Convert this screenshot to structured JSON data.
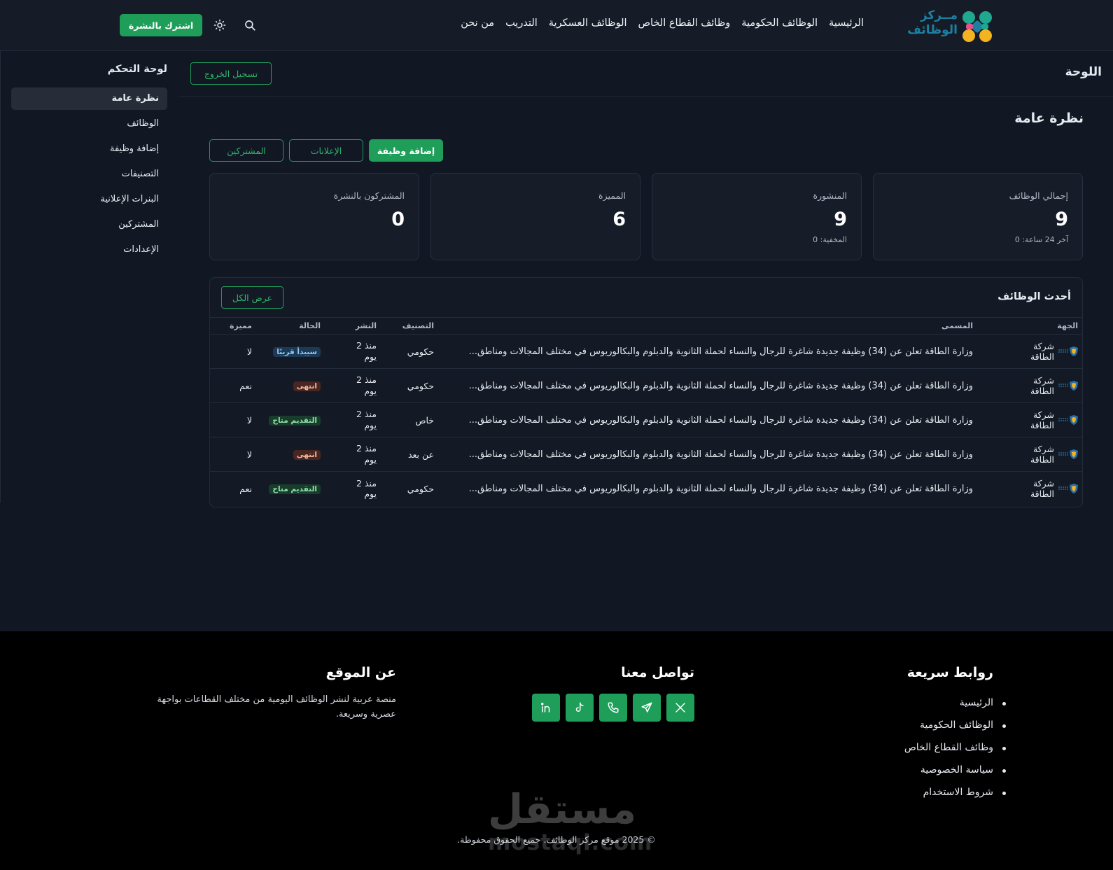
{
  "header": {
    "logo_line1": "مــركز",
    "logo_line2": "الوظائف",
    "nav": [
      "الرئيسية",
      "الوظائف الحكومية",
      "وظائف القطاع الخاص",
      "الوظائف العسكرية",
      "التدريب",
      "من نحن"
    ],
    "subscribe_label": "اشترك بالنشرة",
    "search_icon": "search-icon",
    "theme_icon": "sun-icon"
  },
  "sidebar": {
    "title": "لوحة التحكم",
    "items": [
      {
        "label": "نظرة عامة",
        "active": true
      },
      {
        "label": "الوظائف"
      },
      {
        "label": "إضافة وظيفة"
      },
      {
        "label": "التصنيفات"
      },
      {
        "label": "البنرات الإعلانية"
      },
      {
        "label": "المشتركين"
      },
      {
        "label": "الإعدادات"
      }
    ]
  },
  "main": {
    "page_title": "اللوحة",
    "logout_label": "تسجيل الخروج",
    "section_title": "نظرة عامة",
    "actions": {
      "add_job": "إضافة وظيفة",
      "ads": "الإعلانات",
      "subscribers": "المشتركين"
    },
    "stats": [
      {
        "label": "إجمالي الوظائف",
        "value": "9",
        "sub": "آخر 24 ساعة: 0"
      },
      {
        "label": "المنشورة",
        "value": "9",
        "sub": "المخفية: 0"
      },
      {
        "label": "المميزة",
        "value": "6",
        "sub": ""
      },
      {
        "label": "المشتركون بالنشرة",
        "value": "0",
        "sub": ""
      }
    ],
    "latest_jobs": {
      "title": "أحدث الوظائف",
      "view_all": "عرض الكل",
      "columns": [
        "الجهة",
        "المسمى",
        "التصنيف",
        "النشر",
        "الحالة",
        "مميزة"
      ],
      "rows": [
        {
          "org": "شركة الطاقة",
          "title": "وزارة الطاقة تعلن عن (34) وظيفة جديدة شاغرة للرجال والنساء لحملة الثانوية والدبلوم والبكالوريوس في مختلف المجالات ومناطق...",
          "category": "حكومي",
          "date": "منذ 2 يوم",
          "status": "سيبدأ قريبًا",
          "status_kind": "soon",
          "featured": "لا"
        },
        {
          "org": "شركة الطاقة",
          "title": "وزارة الطاقة تعلن عن (34) وظيفة جديدة شاغرة للرجال والنساء لحملة الثانوية والدبلوم والبكالوريوس في مختلف المجالات ومناطق...",
          "category": "حكومي",
          "date": "منذ 2 يوم",
          "status": "انتهى",
          "status_kind": "ended",
          "featured": "نعم"
        },
        {
          "org": "شركة الطاقة",
          "title": "وزارة الطاقة تعلن عن (34) وظيفة جديدة شاغرة للرجال والنساء لحملة الثانوية والدبلوم والبكالوريوس في مختلف المجالات ومناطق...",
          "category": "خاص",
          "date": "منذ 2 يوم",
          "status": "التقديم متاح",
          "status_kind": "open",
          "featured": "لا"
        },
        {
          "org": "شركة الطاقة",
          "title": "وزارة الطاقة تعلن عن (34) وظيفة جديدة شاغرة للرجال والنساء لحملة الثانوية والدبلوم والبكالوريوس في مختلف المجالات ومناطق...",
          "category": "عن بعد",
          "date": "منذ 2 يوم",
          "status": "انتهى",
          "status_kind": "ended",
          "featured": "لا"
        },
        {
          "org": "شركة الطاقة",
          "title": "وزارة الطاقة تعلن عن (34) وظيفة جديدة شاغرة للرجال والنساء لحملة الثانوية والدبلوم والبكالوريوس في مختلف المجالات ومناطق...",
          "category": "حكومي",
          "date": "منذ 2 يوم",
          "status": "التقديم متاح",
          "status_kind": "open",
          "featured": "نعم"
        }
      ]
    }
  },
  "footer": {
    "quick_links_title": "روابط سريعة",
    "quick_links": [
      "الرئيسية",
      "الوظائف الحكومية",
      "وظائف القطاع الخاص",
      "سياسة الخصوصية",
      "شروط الاستخدام"
    ],
    "contact_title": "تواصل معنا",
    "social_icons": [
      "x-icon",
      "telegram-icon",
      "phone-icon",
      "tiktok-icon",
      "linkedin-icon"
    ],
    "about_title": "عن الموقع",
    "about_text": "منصة عربية لنشر الوظائف اليومية من مختلف القطاعات بواجهة عصرية وسريعة.",
    "copyright": "© 2025 موقع مركز الوظائف. جميع الحقوق محفوظة.",
    "watermark_ar": "مستقل",
    "watermark_en": "mostaql.com"
  },
  "colors": {
    "accent": "#1f9e5a",
    "background": "#111723",
    "card": "#161d29",
    "footer": "#000000"
  }
}
